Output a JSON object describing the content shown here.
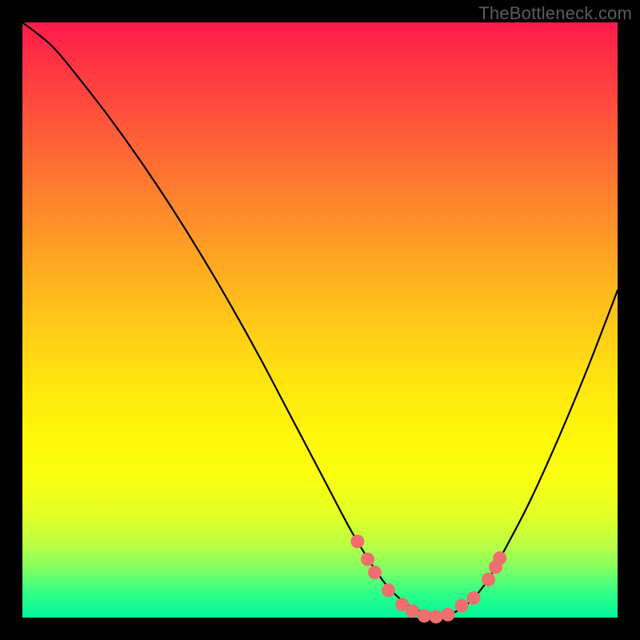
{
  "watermark": "TheBottleneck.com",
  "colors": {
    "background": "#000000",
    "curve_stroke": "#000000",
    "dot_fill": "#ef6e6e",
    "dot_stroke": "#d85a5a"
  },
  "chart_data": {
    "type": "line",
    "title": "",
    "xlabel": "",
    "ylabel": "",
    "xlim": [
      0,
      100
    ],
    "ylim": [
      0,
      100
    ],
    "grid": false,
    "series": [
      {
        "name": "bottleneck-curve",
        "x": [
          0,
          5,
          10,
          15,
          20,
          25,
          30,
          35,
          40,
          45,
          50,
          55,
          58,
          60,
          62,
          65,
          68,
          70,
          72,
          75,
          78,
          80,
          85,
          90,
          95,
          100
        ],
        "y": [
          100,
          96,
          90,
          83.5,
          76.5,
          69,
          61,
          52.5,
          43.5,
          34,
          24.5,
          15,
          10,
          7,
          4.5,
          2,
          0.6,
          0.15,
          0.6,
          2.5,
          6,
          9.5,
          19,
          30,
          42,
          55
        ]
      }
    ],
    "markers": {
      "name": "highlighted-points",
      "x": [
        56.3,
        58.0,
        59.2,
        61.5,
        63.8,
        65.5,
        67.5,
        69.5,
        71.5,
        73.8,
        75.8,
        78.3,
        79.5,
        80.2
      ],
      "y": [
        12.8,
        9.8,
        7.6,
        4.6,
        2.2,
        1.1,
        0.3,
        0.15,
        0.5,
        2.0,
        3.3,
        6.4,
        8.5,
        10.0
      ]
    }
  }
}
